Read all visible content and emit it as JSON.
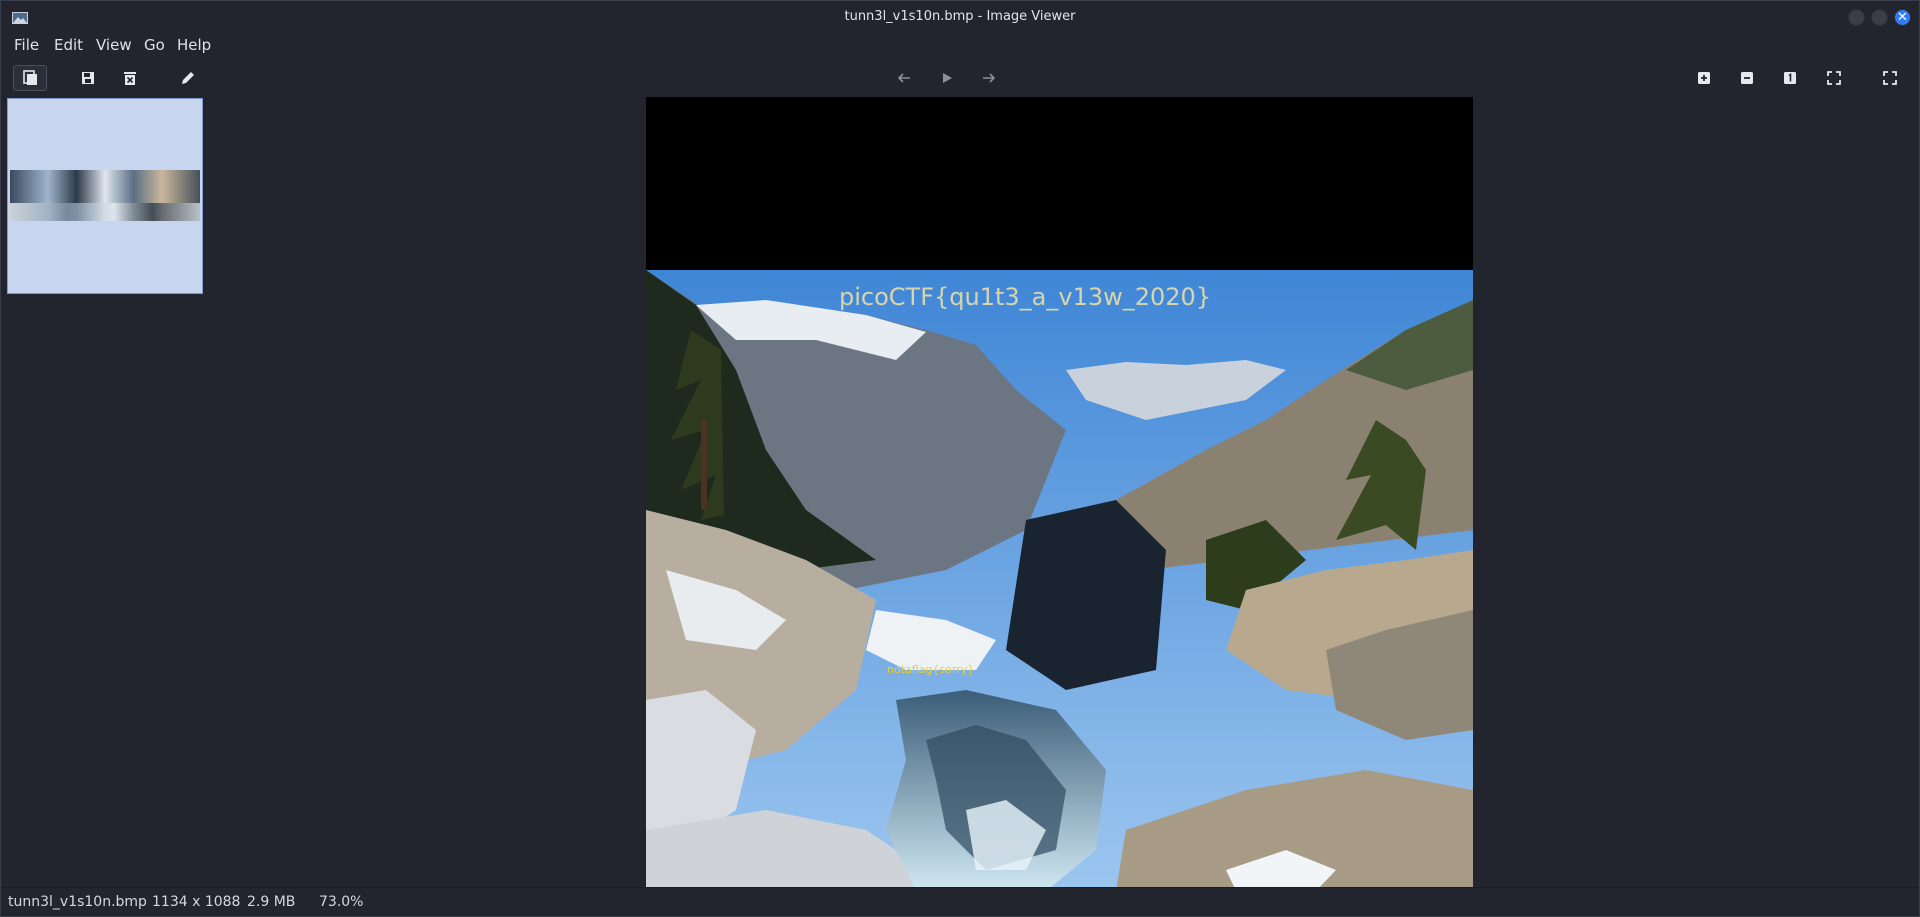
{
  "window": {
    "title": "tunn3l_v1s10n.bmp - Image Viewer",
    "close_glyph": "✕"
  },
  "menu": {
    "items": [
      "File",
      "Edit",
      "View",
      "Go",
      "Help"
    ]
  },
  "toolbar": {
    "left_icons": [
      "gallery-icon",
      "save-icon",
      "delete-icon",
      "edit-icon"
    ],
    "center_icons": [
      "back-arrow-icon",
      "play-icon",
      "forward-arrow-icon"
    ],
    "right_icons": [
      "zoom-in-icon",
      "zoom-out-icon",
      "normal-size-icon",
      "fit-icon",
      "fullscreen-icon"
    ]
  },
  "image": {
    "overlay_text": "picoCTF{qu1t3_a_v13w_2020}",
    "inner_text": "notaflag{sorry}"
  },
  "status": {
    "filename": "tunn3l_v1s10n.bmp",
    "dimensions": "1134 x 1088",
    "filesize": "2.9 MB",
    "zoom": "73.0%"
  },
  "colors": {
    "background": "#22252e",
    "thumb_selected": "#c7d5ee",
    "close_button": "#2f7df6"
  }
}
